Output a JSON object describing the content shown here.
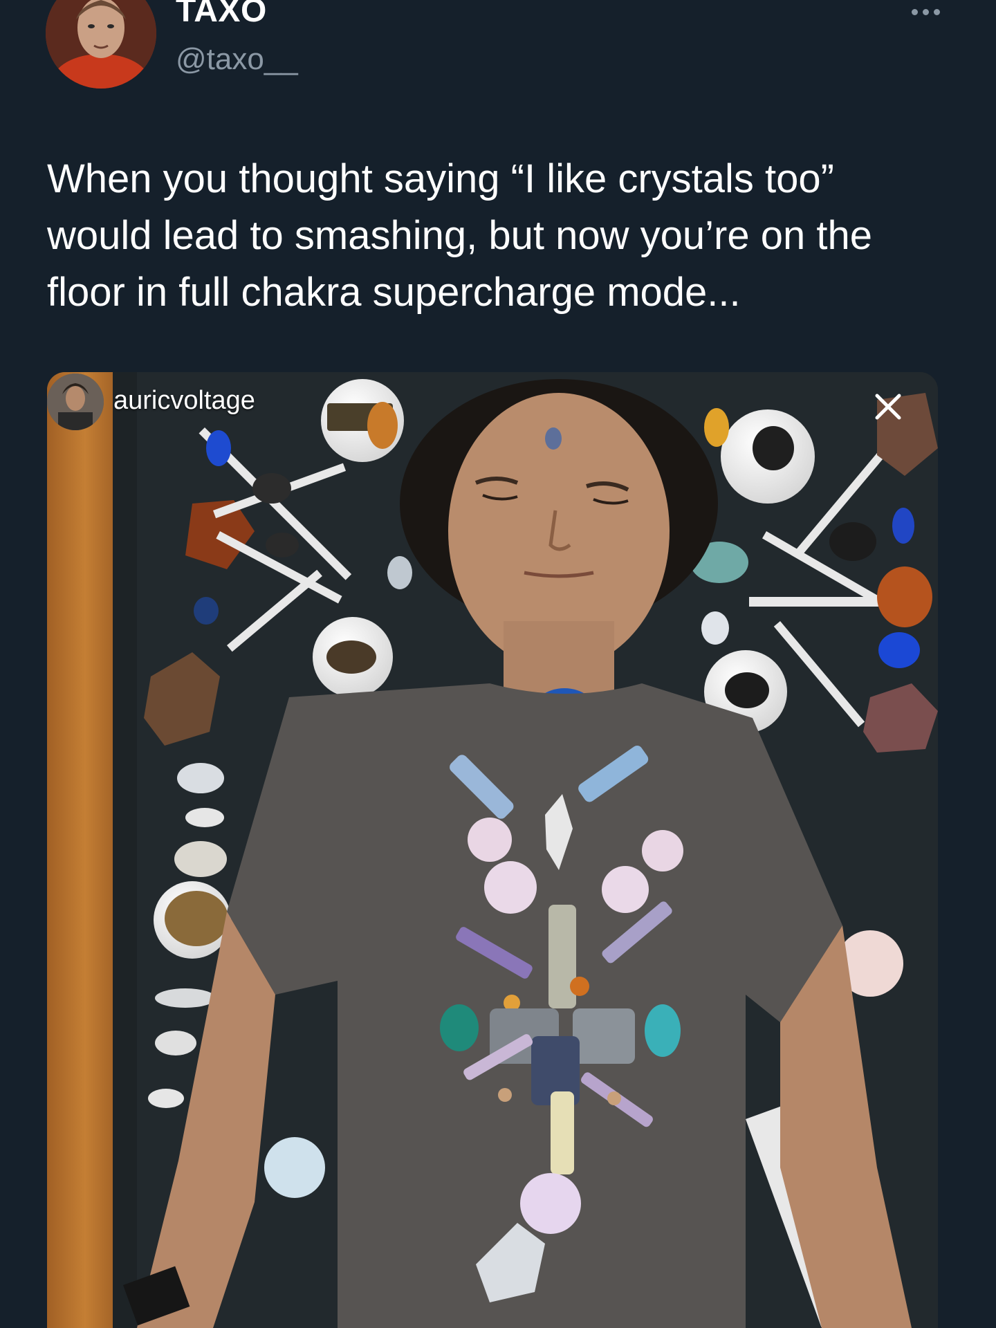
{
  "tweet": {
    "display_name": "TAXO",
    "handle": "@taxo__",
    "text": "When you thought saying “I like crystals too”\nwould lead to smashing, but now you’re on the\nfloor in full chakra supercharge mode...",
    "more_icon": "more-horizontal-icon"
  },
  "media": {
    "overlay_username": "auricvoltage",
    "close_icon": "close-icon",
    "description_icon": "photo"
  },
  "colors": {
    "background": "#15202b",
    "secondary_text": "#8b98a5",
    "primary_text": "#ffffff"
  }
}
